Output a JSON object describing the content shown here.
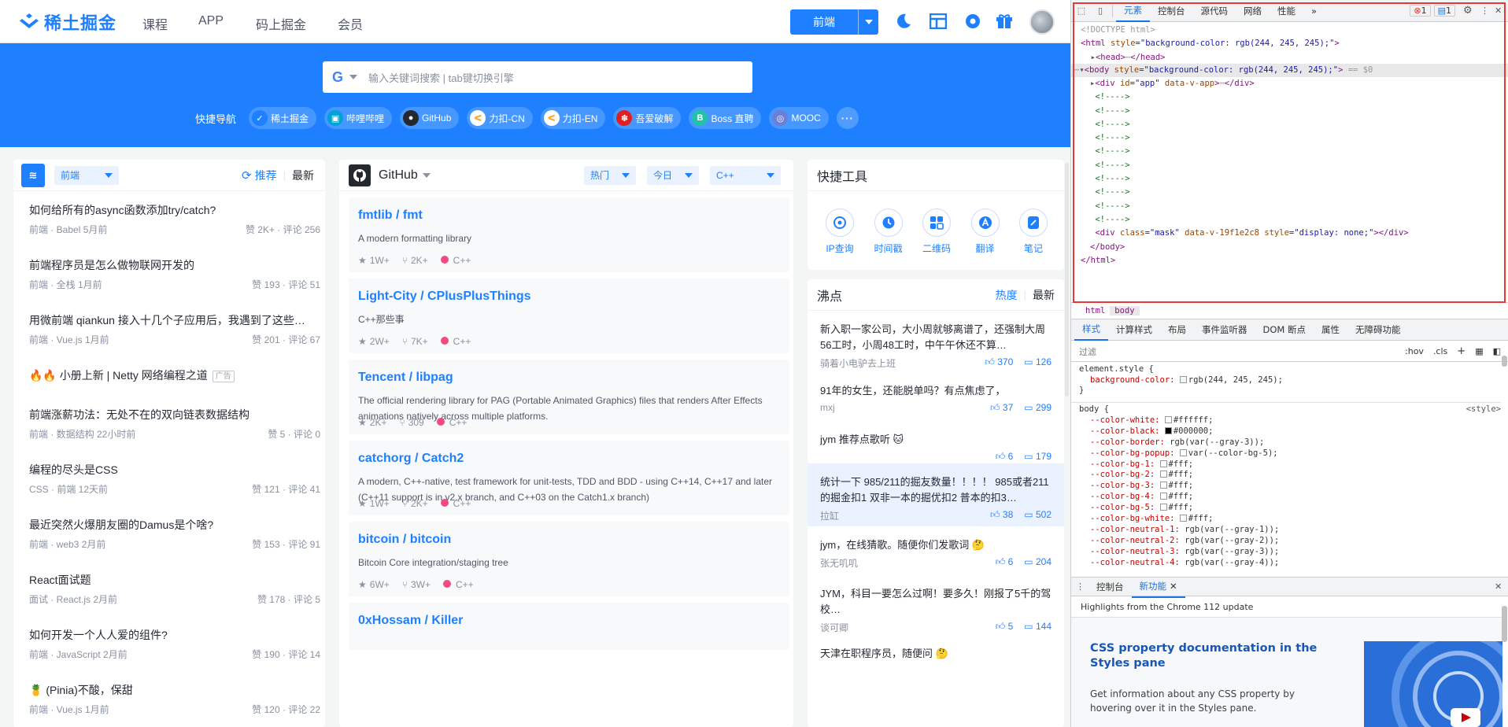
{
  "header": {
    "brand": "稀土掘金",
    "nav": [
      "课程",
      "APP",
      "码上掘金",
      "会员"
    ],
    "category_button": "前端",
    "icons": [
      "moon-icon",
      "layout-icon",
      "settings-icon",
      "gift-icon"
    ]
  },
  "hero": {
    "search_placeholder": "输入关键词搜索 | tab键切换引擎",
    "quick_nav_title": "快捷导航",
    "quick_links": [
      {
        "label": "稀土掘金",
        "color": "#1e80ff"
      },
      {
        "label": "哔哩哔哩",
        "color": "#00a1d6"
      },
      {
        "label": "GitHub",
        "color": "#24292f"
      },
      {
        "label": "力扣-CN",
        "color": "#ffa116"
      },
      {
        "label": "力扣-EN",
        "color": "#ffa116"
      },
      {
        "label": "吾爱破解",
        "color": "#e02020"
      },
      {
        "label": "Boss 直聘",
        "color": "#21c3a6"
      },
      {
        "label": "MOOC",
        "color": "#6b7fd7"
      }
    ]
  },
  "left_panel": {
    "category": "前端",
    "tab_recommend": "推荐",
    "tab_latest": "最新",
    "articles": [
      {
        "title": "如何给所有的async函数添加try/catch?",
        "meta": "前端 · Babel   5月前",
        "stats": "赞 2K+ · 评论 256"
      },
      {
        "title": "前端程序员是怎么做物联网开发的",
        "meta": "前端 · 全栈   1月前",
        "stats": "赞 193 · 评论 51"
      },
      {
        "title": "用微前端 qiankun 接入十几个子应用后，我遇到了这些…",
        "meta": "前端 · Vue.js   1月前",
        "stats": "赞 201 · 评论 67"
      },
      {
        "title": "🔥🔥 小册上新 | Netty 网络编程之道",
        "meta": "",
        "stats": "",
        "ad": "广告"
      },
      {
        "title": "前端涨薪功法：无处不在的双向链表数据结构",
        "meta": "前端 · 数据结构   22小时前",
        "stats": "赞 5 · 评论 0"
      },
      {
        "title": "编程的尽头是CSS",
        "meta": "CSS · 前端   12天前",
        "stats": "赞 121 · 评论 41"
      },
      {
        "title": "最近突然火爆朋友圈的Damus是个啥?",
        "meta": "前端 · web3   2月前",
        "stats": "赞 153 · 评论 91"
      },
      {
        "title": "React面试题",
        "meta": "面试 · React.js   2月前",
        "stats": "赞 178 · 评论 5"
      },
      {
        "title": "如何开发一个人人爱的组件?",
        "meta": "前端 · JavaScript   2月前",
        "stats": "赞 190 · 评论 14"
      },
      {
        "title": "🍍 (Pinia)不酸，保甜",
        "meta": "前端 · Vue.js   1月前",
        "stats": "赞 120 · 评论 22"
      }
    ]
  },
  "github_panel": {
    "title": "GitHub",
    "filter_hot": "热门",
    "filter_today": "今日",
    "filter_lang": "C++",
    "repos": [
      {
        "name": "fmtlib / fmt",
        "desc": "A modern formatting library",
        "stars": "1W+",
        "forks": "2K+",
        "lang": "C++"
      },
      {
        "name": "Light-City / CPlusPlusThings",
        "desc": "C++那些事",
        "stars": "2W+",
        "forks": "7K+",
        "lang": "C++"
      },
      {
        "name": "Tencent / libpag",
        "desc": "The official rendering library for PAG (Portable Animated Graphics) files that renders After Effects animations natively across multiple platforms.",
        "stars": "2K+",
        "forks": "309",
        "lang": "C++"
      },
      {
        "name": "catchorg / Catch2",
        "desc": "A modern, C++-native, test framework for unit-tests, TDD and BDD - using C++14, C++17 and later (C++11 support is in v2.x branch, and C++03 on the Catch1.x branch)",
        "stars": "1W+",
        "forks": "2K+",
        "lang": "C++"
      },
      {
        "name": "bitcoin / bitcoin",
        "desc": "Bitcoin Core integration/staging tree",
        "stars": "6W+",
        "forks": "3W+",
        "lang": "C++"
      },
      {
        "name": "0xHossam / Killer",
        "desc": "",
        "stars": "",
        "forks": "",
        "lang": ""
      }
    ]
  },
  "tools_panel": {
    "title": "快捷工具",
    "tools": [
      {
        "label": "IP查询",
        "icon": "ip-icon"
      },
      {
        "label": "时间戳",
        "icon": "clock-icon"
      },
      {
        "label": "二维码",
        "icon": "qrcode-icon"
      },
      {
        "label": "翻译",
        "icon": "translate-icon"
      },
      {
        "label": "笔记",
        "icon": "note-icon"
      }
    ]
  },
  "pins_panel": {
    "title": "沸点",
    "tab_hot": "热度",
    "tab_latest": "最新",
    "pins": [
      {
        "text": "新入职一家公司，大小周就够离谱了，还强制大周56工时，小周48工时，中午午休还不算…",
        "author": "骑着小电驴去上班",
        "likes": "370",
        "comments": "126"
      },
      {
        "text": "91年的女生，还能脱单吗？有点焦虑了，",
        "author": "mxj",
        "likes": "37",
        "comments": "299"
      },
      {
        "text": "jym 推荐点歌听 🐱",
        "author": "",
        "likes": "6",
        "comments": "179"
      },
      {
        "text": "统计一下 985/211的掘友数量！！！！ 985或者211的掘金扣1 双非一本的掘优扣2 普本的扣3…",
        "author": "拉缸",
        "likes": "38",
        "comments": "502",
        "highlight": true
      },
      {
        "text": "jym，在线猜歌。随便你们发歌词 🤔",
        "author": "张无叽叽",
        "likes": "6",
        "comments": "204"
      },
      {
        "text": "JYM，科目一要怎么过啊！要多久！刚报了5千的驾校…",
        "author": "谈可卿",
        "likes": "5",
        "comments": "144"
      },
      {
        "text": "天津在职程序员，随便问 🤔",
        "author": "",
        "likes": "",
        "comments": ""
      }
    ]
  },
  "devtools": {
    "tabs": [
      "元素",
      "控制台",
      "源代码",
      "网络",
      "性能"
    ],
    "more": "»",
    "errors": "1",
    "messages": "1",
    "breadcrumb": [
      "html",
      "body"
    ],
    "style_tabs": [
      "样式",
      "计算样式",
      "布局",
      "事件监听器",
      "DOM 断点",
      "属性",
      "无障碍功能"
    ],
    "filter_placeholder": "过滤",
    "hov": ":hov",
    "cls": ".cls",
    "element_style_header": "element.style {",
    "element_style_prop": "background-color:",
    "element_style_value": "rgb(244, 245, 245);",
    "body_rule_header": "body {",
    "body_rule_source": "<style>",
    "vars": [
      {
        "name": "--color-white:",
        "value": "#ffffff;",
        "swatch": "#ffffff"
      },
      {
        "name": "--color-black:",
        "value": "#000000;",
        "swatch": "#000000"
      },
      {
        "name": "--color-border:",
        "value": "rgb(var(--gray-3));",
        "swatch": ""
      },
      {
        "name": "--color-bg-popup:",
        "value": "var(--color-bg-5);",
        "swatch": "#ffffff"
      },
      {
        "name": "--color-bg-1:",
        "value": "#fff;",
        "swatch": "#ffffff"
      },
      {
        "name": "--color-bg-2:",
        "value": "#fff;",
        "swatch": "#ffffff"
      },
      {
        "name": "--color-bg-3:",
        "value": "#fff;",
        "swatch": "#ffffff"
      },
      {
        "name": "--color-bg-4:",
        "value": "#fff;",
        "swatch": "#ffffff"
      },
      {
        "name": "--color-bg-5:",
        "value": "#fff;",
        "swatch": "#ffffff"
      },
      {
        "name": "--color-bg-white:",
        "value": "#fff;",
        "swatch": "#ffffff"
      },
      {
        "name": "--color-neutral-1:",
        "value": "rgb(var(--gray-1));",
        "swatch": ""
      },
      {
        "name": "--color-neutral-2:",
        "value": "rgb(var(--gray-2));",
        "swatch": ""
      },
      {
        "name": "--color-neutral-3:",
        "value": "rgb(var(--gray-3));",
        "swatch": ""
      },
      {
        "name": "--color-neutral-4:",
        "value": "rgb(var(--gray-4));",
        "swatch": ""
      }
    ],
    "drawer_tabs": [
      "控制台",
      "新功能"
    ],
    "whatsnew_header": "Highlights from the Chrome 112 update",
    "whatsnew_title": "CSS property documentation in the Styles pane",
    "whatsnew_body": "Get information about any CSS property by hovering over it in the Styles pane."
  }
}
